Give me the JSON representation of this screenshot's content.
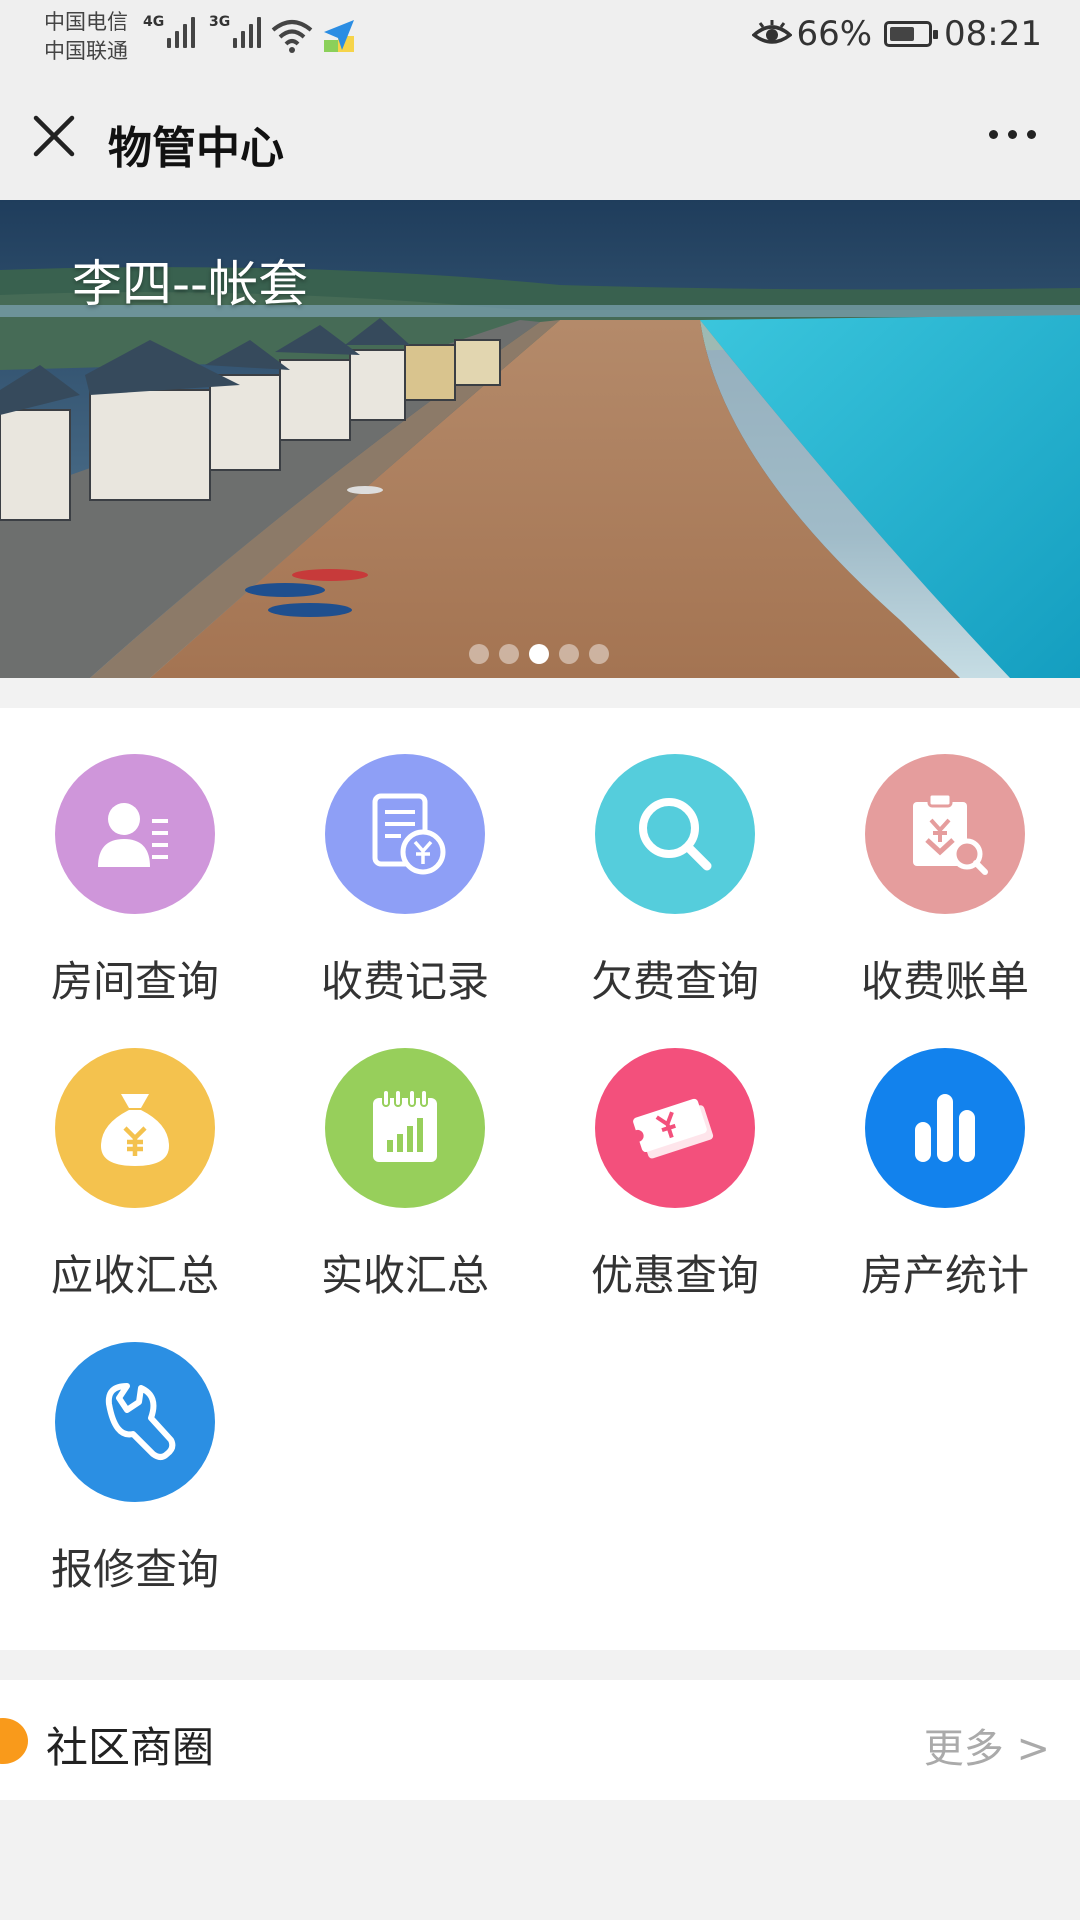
{
  "status_bar": {
    "carrier1": "中国电信",
    "carrier2": "中国联通",
    "net1": "4G",
    "net2": "3G",
    "battery": "66%",
    "time": "08:21",
    "icons": [
      "signal-icon",
      "wifi-icon",
      "app-notification-icon",
      "eye-icon",
      "battery-icon"
    ]
  },
  "nav": {
    "title": "物管中心",
    "close_icon": "close-icon",
    "more_icon": "more-icon"
  },
  "banner": {
    "title": "李四--帐套",
    "slide_count": 5,
    "active_slide": 3
  },
  "grid": {
    "items": [
      {
        "label": "房间查询",
        "icon": "person-card-icon",
        "color": "#cf96da"
      },
      {
        "label": "收费记录",
        "icon": "receipt-yuan-icon",
        "color": "#8e9ff6"
      },
      {
        "label": "欠费查询",
        "icon": "search-icon",
        "color": "#55cddc"
      },
      {
        "label": "收费账单",
        "icon": "bill-search-icon",
        "color": "#e59d9d"
      },
      {
        "label": "应收汇总",
        "icon": "money-bag-icon",
        "color": "#f4c24e"
      },
      {
        "label": "实收汇总",
        "icon": "calendar-chart-icon",
        "color": "#97cf5b"
      },
      {
        "label": "优惠查询",
        "icon": "coupon-icon",
        "color": "#f3507c"
      },
      {
        "label": "房产统计",
        "icon": "bar-stats-icon",
        "color": "#1282ed"
      },
      {
        "label": "报修查询",
        "icon": "wrench-icon",
        "color": "#2b8fe3"
      }
    ]
  },
  "community": {
    "title": "社区商圈",
    "more": "更多 >",
    "accent": "#f99a1b"
  }
}
